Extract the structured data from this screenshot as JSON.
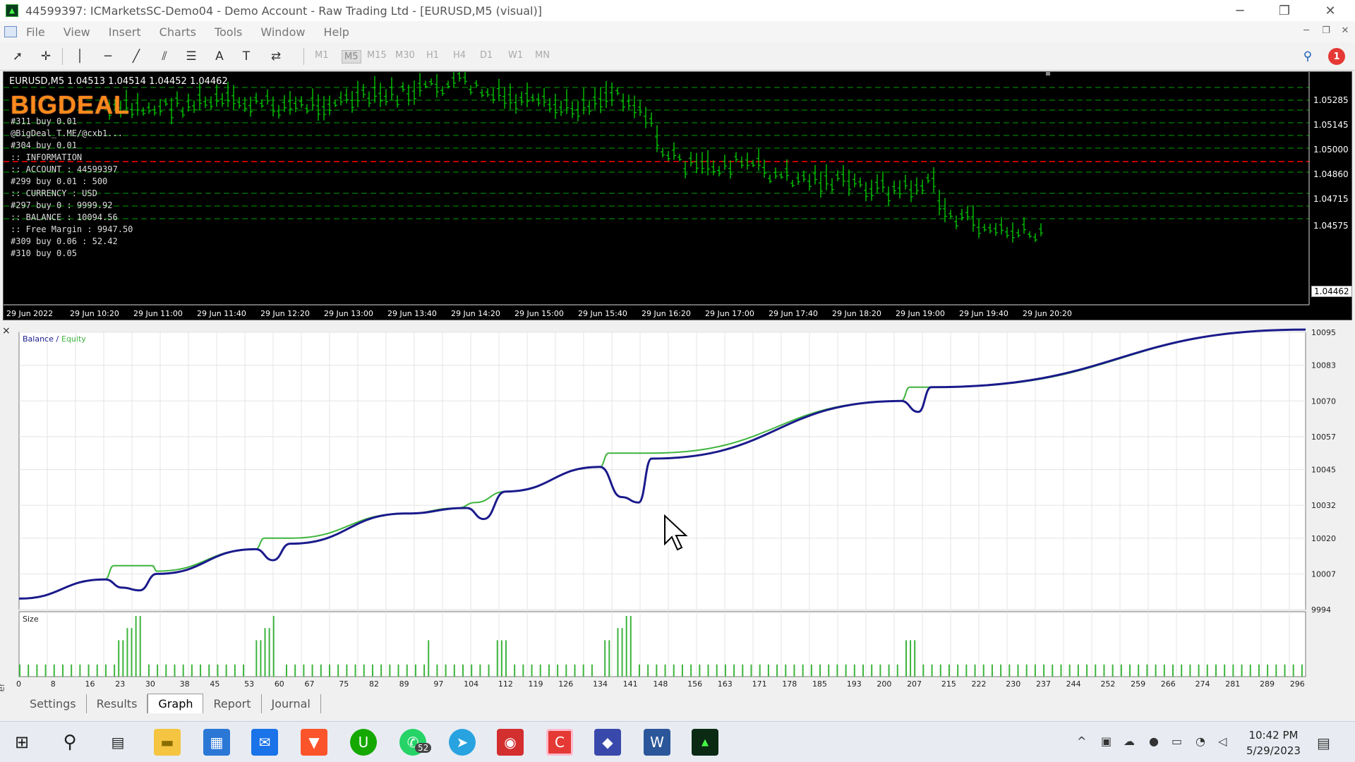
{
  "window": {
    "title": "44599397: ICMarketsSC-Demo04 - Demo Account - Raw Trading Ltd - [EURUSD,M5 (visual)]",
    "minimize": "─",
    "restore": "❐",
    "close": "✕"
  },
  "menu": [
    "File",
    "View",
    "Insert",
    "Charts",
    "Tools",
    "Window",
    "Help"
  ],
  "toolbar": {
    "timeframes": [
      "M1",
      "M5",
      "M15",
      "M30",
      "H1",
      "H4",
      "D1",
      "W1",
      "MN"
    ],
    "active_timeframe": "M5",
    "notification_count": "1"
  },
  "chart": {
    "symbol_line": "EURUSD,M5  1.04513 1.04514 1.04452 1.04462",
    "ea_logo": "BIGDEAL",
    "info_lines": [
      "#311 buy 0.01",
      "@BigDeal_T.ME/@cxb1...",
      "#304 buy 0.01",
      ":: INFORMATION",
      ":: ACCOUNT : 44599397",
      "#299 buy 0.01 : 500",
      ":: CURRENCY : USD",
      "#297 buy 0 : 9999.92",
      ":: BALANCE : 10094.56",
      ":: Free Margin : 9947.50",
      "#309 buy 0.06 : 52.42",
      "#310 buy 0.05"
    ],
    "price_labels": [
      "1.05285",
      "1.05145",
      "1.05000",
      "1.04860",
      "1.04715",
      "1.04575"
    ],
    "current_price": "1.04462",
    "time_labels": [
      "29 Jun 2022",
      "29 Jun 10:20",
      "29 Jun 11:00",
      "29 Jun 11:40",
      "29 Jun 12:20",
      "29 Jun 13:00",
      "29 Jun 13:40",
      "29 Jun 14:20",
      "29 Jun 15:00",
      "29 Jun 15:40",
      "29 Jun 16:20",
      "29 Jun 17:00",
      "29 Jun 17:40",
      "29 Jun 18:20",
      "29 Jun 19:00",
      "29 Jun 19:40",
      "29 Jun 20:20"
    ],
    "colors": {
      "candle": "#00c800",
      "level_line": "#00a000",
      "red_line": "#c00000"
    }
  },
  "chart_data": {
    "type": "line",
    "title": "",
    "legend": [
      "Balance",
      "Equity"
    ],
    "series": [
      {
        "name": "Balance",
        "color": "#1a1a8c"
      },
      {
        "name": "Equity",
        "color": "#3cb43c"
      }
    ],
    "x": [
      0,
      8,
      16,
      23,
      30,
      38,
      45,
      53,
      60,
      67,
      75,
      82,
      89,
      97,
      104,
      112,
      119,
      126,
      134,
      141,
      148,
      156,
      163,
      171,
      178,
      185,
      193,
      200,
      207,
      215,
      222,
      230,
      237,
      244,
      252,
      259,
      266,
      274,
      281,
      289,
      296
    ],
    "y_ticks": [
      10095,
      10083,
      10070,
      10057,
      10045,
      10032,
      10020,
      10007,
      9994
    ],
    "ylim": [
      9994,
      10095
    ],
    "xlim": [
      0,
      299
    ],
    "balance_points": [
      [
        0,
        9998
      ],
      [
        20,
        10005
      ],
      [
        24,
        10002
      ],
      [
        28,
        10001
      ],
      [
        32,
        10007
      ],
      [
        55,
        10016
      ],
      [
        59,
        10012
      ],
      [
        63,
        10018
      ],
      [
        90,
        10029
      ],
      [
        104,
        10031
      ],
      [
        108,
        10027
      ],
      [
        113,
        10037
      ],
      [
        135,
        10046
      ],
      [
        140,
        10035
      ],
      [
        144,
        10033
      ],
      [
        147,
        10049
      ],
      [
        205,
        10070
      ],
      [
        209,
        10066
      ],
      [
        212,
        10075
      ],
      [
        299,
        10096
      ]
    ],
    "equity_points": [
      [
        0,
        9998
      ],
      [
        20,
        10005
      ],
      [
        22,
        10010
      ],
      [
        31,
        10010
      ],
      [
        32,
        10008
      ],
      [
        55,
        10016
      ],
      [
        57,
        10020
      ],
      [
        63,
        10020
      ],
      [
        90,
        10029
      ],
      [
        102,
        10031
      ],
      [
        106,
        10033
      ],
      [
        113,
        10037
      ],
      [
        135,
        10046
      ],
      [
        137,
        10051
      ],
      [
        147,
        10051
      ],
      [
        205,
        10070
      ],
      [
        207,
        10075
      ],
      [
        213,
        10075
      ],
      [
        299,
        10096
      ]
    ],
    "size_label": "Size",
    "size_bars": [
      [
        0,
        0.2
      ],
      [
        2,
        0.2
      ],
      [
        4,
        0.2
      ],
      [
        6,
        0.2
      ],
      [
        8,
        0.2
      ],
      [
        10,
        0.2
      ],
      [
        12,
        0.2
      ],
      [
        14,
        0.2
      ],
      [
        16,
        0.2
      ],
      [
        18,
        0.2
      ],
      [
        20,
        0.2
      ],
      [
        22,
        0.2
      ],
      [
        23,
        0.6
      ],
      [
        24,
        0.6
      ],
      [
        25,
        0.8
      ],
      [
        26,
        0.8
      ],
      [
        27,
        1.0
      ],
      [
        28,
        1.0
      ],
      [
        30,
        0.2
      ],
      [
        32,
        0.2
      ],
      [
        34,
        0.2
      ],
      [
        36,
        0.2
      ],
      [
        38,
        0.2
      ],
      [
        40,
        0.2
      ],
      [
        42,
        0.2
      ],
      [
        44,
        0.2
      ],
      [
        46,
        0.2
      ],
      [
        48,
        0.2
      ],
      [
        50,
        0.2
      ],
      [
        52,
        0.2
      ],
      [
        55,
        0.6
      ],
      [
        56,
        0.6
      ],
      [
        57,
        0.8
      ],
      [
        58,
        0.8
      ],
      [
        59,
        1.0
      ],
      [
        62,
        0.2
      ],
      [
        64,
        0.2
      ],
      [
        66,
        0.2
      ],
      [
        68,
        0.2
      ],
      [
        70,
        0.2
      ],
      [
        72,
        0.2
      ],
      [
        74,
        0.2
      ],
      [
        76,
        0.2
      ],
      [
        78,
        0.2
      ],
      [
        80,
        0.2
      ],
      [
        82,
        0.2
      ],
      [
        84,
        0.2
      ],
      [
        86,
        0.2
      ],
      [
        88,
        0.2
      ],
      [
        90,
        0.2
      ],
      [
        92,
        0.2
      ],
      [
        94,
        0.2
      ],
      [
        95,
        0.6
      ],
      [
        97,
        0.2
      ],
      [
        99,
        0.2
      ],
      [
        101,
        0.2
      ],
      [
        103,
        0.2
      ],
      [
        105,
        0.2
      ],
      [
        107,
        0.2
      ],
      [
        109,
        0.2
      ],
      [
        111,
        0.6
      ],
      [
        112,
        0.6
      ],
      [
        113,
        0.6
      ],
      [
        115,
        0.2
      ],
      [
        117,
        0.2
      ],
      [
        119,
        0.2
      ],
      [
        121,
        0.2
      ],
      [
        123,
        0.2
      ],
      [
        125,
        0.2
      ],
      [
        127,
        0.2
      ],
      [
        129,
        0.2
      ],
      [
        131,
        0.2
      ],
      [
        133,
        0.2
      ],
      [
        136,
        0.6
      ],
      [
        137,
        0.6
      ],
      [
        139,
        0.8
      ],
      [
        140,
        0.8
      ],
      [
        141,
        1.0
      ],
      [
        142,
        1.0
      ],
      [
        144,
        0.2
      ],
      [
        146,
        0.2
      ],
      [
        148,
        0.2
      ],
      [
        150,
        0.2
      ],
      [
        152,
        0.2
      ],
      [
        154,
        0.2
      ],
      [
        156,
        0.2
      ],
      [
        158,
        0.2
      ],
      [
        160,
        0.2
      ],
      [
        162,
        0.2
      ],
      [
        164,
        0.2
      ],
      [
        166,
        0.2
      ],
      [
        168,
        0.2
      ],
      [
        170,
        0.2
      ],
      [
        172,
        0.2
      ],
      [
        174,
        0.2
      ],
      [
        176,
        0.2
      ],
      [
        178,
        0.2
      ],
      [
        180,
        0.2
      ],
      [
        182,
        0.2
      ],
      [
        184,
        0.2
      ],
      [
        186,
        0.2
      ],
      [
        188,
        0.2
      ],
      [
        190,
        0.2
      ],
      [
        192,
        0.2
      ],
      [
        194,
        0.2
      ],
      [
        196,
        0.2
      ],
      [
        198,
        0.2
      ],
      [
        200,
        0.2
      ],
      [
        202,
        0.2
      ],
      [
        204,
        0.2
      ],
      [
        206,
        0.6
      ],
      [
        207,
        0.6
      ],
      [
        208,
        0.6
      ],
      [
        210,
        0.2
      ],
      [
        212,
        0.2
      ],
      [
        214,
        0.2
      ],
      [
        216,
        0.2
      ],
      [
        218,
        0.2
      ],
      [
        220,
        0.2
      ],
      [
        222,
        0.2
      ],
      [
        224,
        0.2
      ],
      [
        226,
        0.2
      ],
      [
        228,
        0.2
      ],
      [
        230,
        0.2
      ],
      [
        232,
        0.2
      ],
      [
        234,
        0.2
      ],
      [
        236,
        0.2
      ],
      [
        238,
        0.2
      ],
      [
        240,
        0.2
      ],
      [
        242,
        0.2
      ],
      [
        244,
        0.2
      ],
      [
        246,
        0.2
      ],
      [
        248,
        0.2
      ],
      [
        250,
        0.2
      ],
      [
        252,
        0.2
      ],
      [
        254,
        0.2
      ],
      [
        256,
        0.2
      ],
      [
        258,
        0.2
      ],
      [
        260,
        0.2
      ],
      [
        262,
        0.2
      ],
      [
        264,
        0.2
      ],
      [
        266,
        0.2
      ],
      [
        268,
        0.2
      ],
      [
        270,
        0.2
      ],
      [
        272,
        0.2
      ],
      [
        274,
        0.2
      ],
      [
        276,
        0.2
      ],
      [
        278,
        0.2
      ],
      [
        280,
        0.2
      ],
      [
        282,
        0.2
      ],
      [
        284,
        0.2
      ],
      [
        286,
        0.2
      ],
      [
        288,
        0.2
      ],
      [
        290,
        0.2
      ],
      [
        292,
        0.2
      ],
      [
        294,
        0.2
      ],
      [
        296,
        0.2
      ],
      [
        298,
        0.2
      ]
    ],
    "x_tick_labels": [
      "0",
      "8",
      "16",
      "23",
      "30",
      "38",
      "45",
      "53",
      "60",
      "67",
      "75",
      "82",
      "89",
      "97",
      "104",
      "112",
      "119",
      "126",
      "134",
      "141",
      "148",
      "156",
      "163",
      "171",
      "178",
      "185",
      "193",
      "200",
      "207",
      "215",
      "222",
      "230",
      "237",
      "244",
      "252",
      "259",
      "266",
      "274",
      "281",
      "289",
      "296"
    ],
    "grid": true
  },
  "tester": {
    "label": "Tester",
    "close": "×",
    "tabs": [
      "Settings",
      "Results",
      "Graph",
      "Report",
      "Journal"
    ],
    "active_tab": "Graph"
  },
  "taskbar": {
    "whatsapp_badge": "52",
    "time": "10:42 PM",
    "date": "5/29/2023",
    "apps": [
      "start-icon",
      "search-icon",
      "task-view-icon",
      "file-explorer-icon",
      "store-icon",
      "mail-icon",
      "brave-icon",
      "upwork-icon",
      "whatsapp-icon",
      "telegram-icon",
      "screen-recorder-icon",
      "canva-icon",
      "app-icon",
      "word-icon",
      "metatrader-icon"
    ]
  }
}
